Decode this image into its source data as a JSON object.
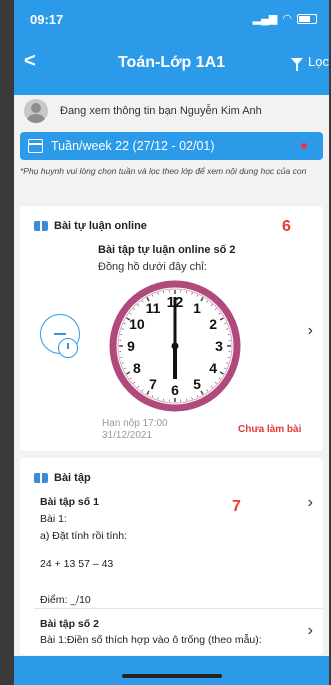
{
  "status_bar": {
    "time": "09:17"
  },
  "header": {
    "back_symbol": "<",
    "title": "Toán-Lớp 1A1",
    "filter_label": "Lọc"
  },
  "user": {
    "text": "Đang xem thông tin bạn Nguyễn Kim Anh"
  },
  "week": {
    "label": "Tuần/week 22 (27/12 - 02/01)"
  },
  "note": "*Phụ huynh vui lòng chọn tuần và lọc theo lớp để xem nội dung học của con",
  "card1": {
    "section_title": "Bài tự luận online",
    "marker": "6",
    "assignment_title": "Bài tập tự luận online số 2",
    "assignment_desc": "Đồng hồ dưới đây chỉ:",
    "deadline_line1": "Hạn nộp 17:00",
    "deadline_line2": "31/12/2021",
    "status": "Chưa làm bài",
    "clock_numbers": [
      "12",
      "1",
      "2",
      "3",
      "4",
      "5",
      "6",
      "7",
      "8",
      "9",
      "10",
      "11"
    ]
  },
  "card2": {
    "section_title": "Bài tập",
    "marker": "7",
    "item1_title": "Bài tập số 1",
    "item1_line1": "Bài 1:",
    "item1_line2": "a) Đặt tính rồi tính:",
    "item1_line3": "24 + 13 57 – 43",
    "item1_score": "Điểm: _/10",
    "item2_title": "Bài tập số 2",
    "item2_line1": "Bài 1:Điền số thích hợp vào ô trống (theo mẫu):"
  },
  "colors": {
    "primary": "#2b9ae8",
    "alert": "#e53935",
    "clock_ring": "#b0497c"
  }
}
